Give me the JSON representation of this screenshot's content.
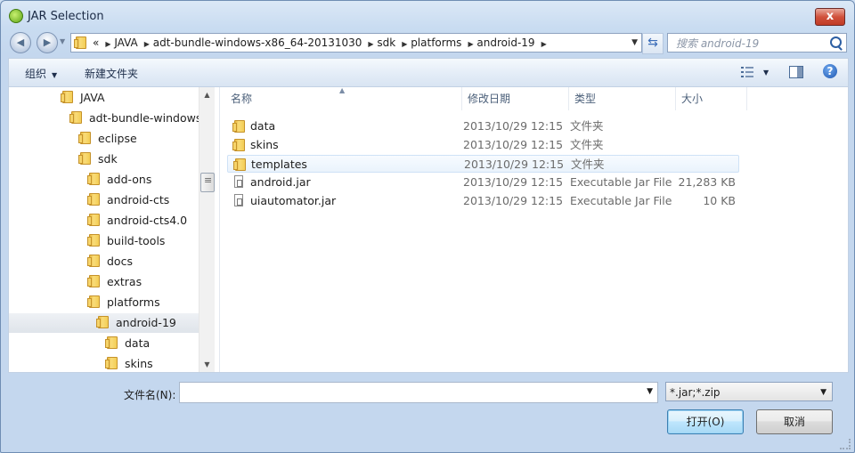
{
  "window": {
    "title": "JAR Selection",
    "close_glyph": "x"
  },
  "nav": {
    "back_glyph": "◀",
    "forward_glyph": "▶",
    "overflow": "«",
    "breadcrumbs": [
      "JAVA",
      "adt-bundle-windows-x86_64-20131030",
      "sdk",
      "platforms",
      "android-19"
    ],
    "search_placeholder": "搜索 android-19"
  },
  "toolbar": {
    "organize": "组织",
    "new_folder": "新建文件夹"
  },
  "tree": {
    "items": [
      {
        "label": "JAVA",
        "depth": 0
      },
      {
        "label": "adt-bundle-windows-",
        "depth": 1
      },
      {
        "label": "eclipse",
        "depth": 2
      },
      {
        "label": "sdk",
        "depth": 2
      },
      {
        "label": "add-ons",
        "depth": 3
      },
      {
        "label": "android-cts",
        "depth": 3
      },
      {
        "label": "android-cts4.0",
        "depth": 3
      },
      {
        "label": "build-tools",
        "depth": 3
      },
      {
        "label": "docs",
        "depth": 3
      },
      {
        "label": "extras",
        "depth": 3
      },
      {
        "label": "platforms",
        "depth": 3
      },
      {
        "label": "android-19",
        "depth": 4,
        "selected": true
      },
      {
        "label": "data",
        "depth": 5
      },
      {
        "label": "skins",
        "depth": 5
      }
    ]
  },
  "files": {
    "columns": {
      "name": "名称",
      "date": "修改日期",
      "type": "类型",
      "size": "大小"
    },
    "rows": [
      {
        "name": "data",
        "date": "2013/10/29 12:15",
        "type": "文件夹",
        "size": "",
        "kind": "folder"
      },
      {
        "name": "skins",
        "date": "2013/10/29 12:15",
        "type": "文件夹",
        "size": "",
        "kind": "folder"
      },
      {
        "name": "templates",
        "date": "2013/10/29 12:15",
        "type": "文件夹",
        "size": "",
        "kind": "folder",
        "hover": true
      },
      {
        "name": "android.jar",
        "date": "2013/10/29 12:15",
        "type": "Executable Jar File",
        "size": "21,283 KB",
        "kind": "jar"
      },
      {
        "name": "uiautomator.jar",
        "date": "2013/10/29 12:15",
        "type": "Executable Jar File",
        "size": "10 KB",
        "kind": "jar"
      }
    ]
  },
  "footer": {
    "filename_label": "文件名(N):",
    "filename_value": "",
    "filter_value": "*.jar;*.zip",
    "open_button": "打开(O)",
    "cancel_button": "取消"
  }
}
